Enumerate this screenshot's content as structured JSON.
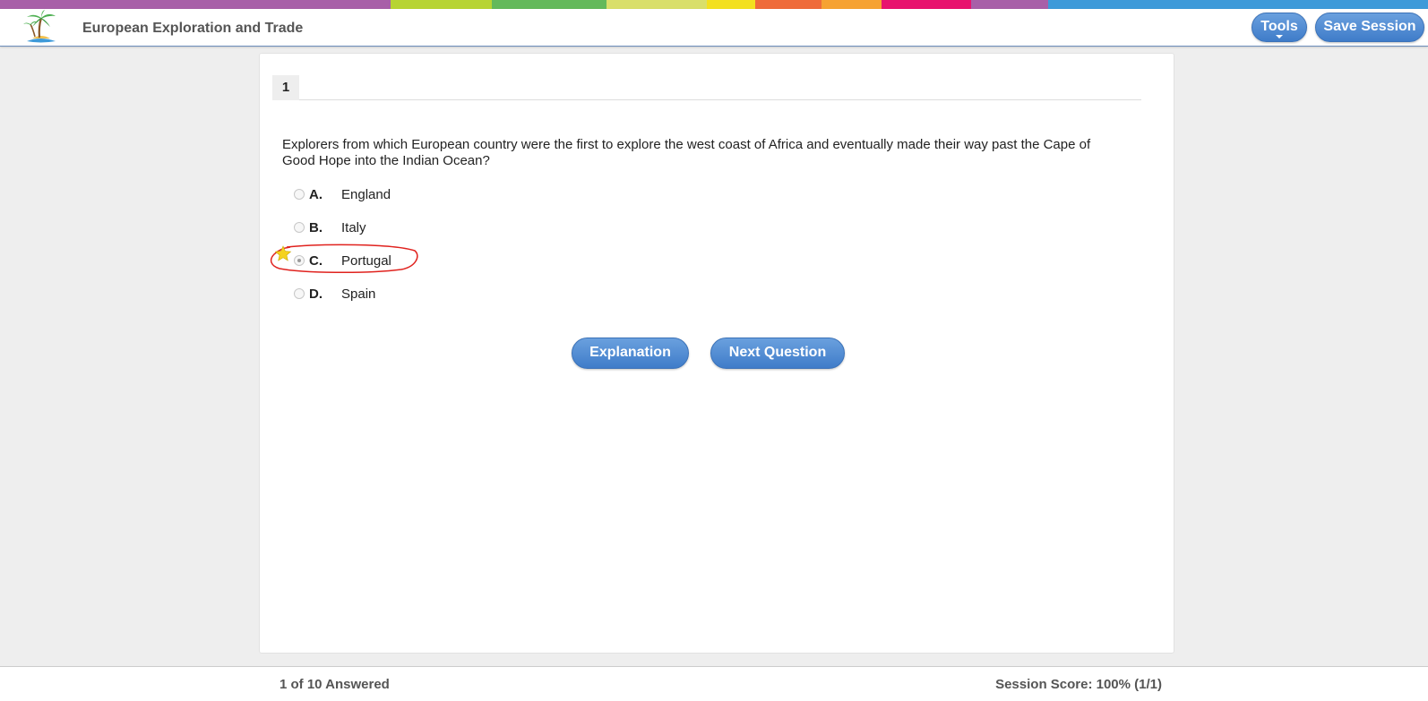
{
  "header": {
    "title": "European Exploration and Trade",
    "tools_label": "Tools",
    "save_label": "Save Session"
  },
  "color_strip": [
    "#a85fa8",
    "#b7d433",
    "#63b95b",
    "#d9df6a",
    "#f3e01f",
    "#ef6b3a",
    "#f6a232",
    "#e8136e",
    "#a85fa8",
    "#3e9ad9"
  ],
  "question": {
    "number": "1",
    "text": "Explorers from which European country were the first to explore the west coast of Africa and eventually made their way past the Cape of Good Hope into the Indian Ocean?",
    "choices": [
      {
        "letter": "A.",
        "text": "England"
      },
      {
        "letter": "B.",
        "text": "Italy"
      },
      {
        "letter": "C.",
        "text": "Portugal"
      },
      {
        "letter": "D.",
        "text": "Spain"
      }
    ],
    "selected_choice": "C.",
    "correct_marker_icon": "star-icon"
  },
  "buttons": {
    "explanation": "Explanation",
    "next_question": "Next Question"
  },
  "footer": {
    "answered": "1 of 10 Answered",
    "score": "Session Score: 100% (1/1)"
  }
}
